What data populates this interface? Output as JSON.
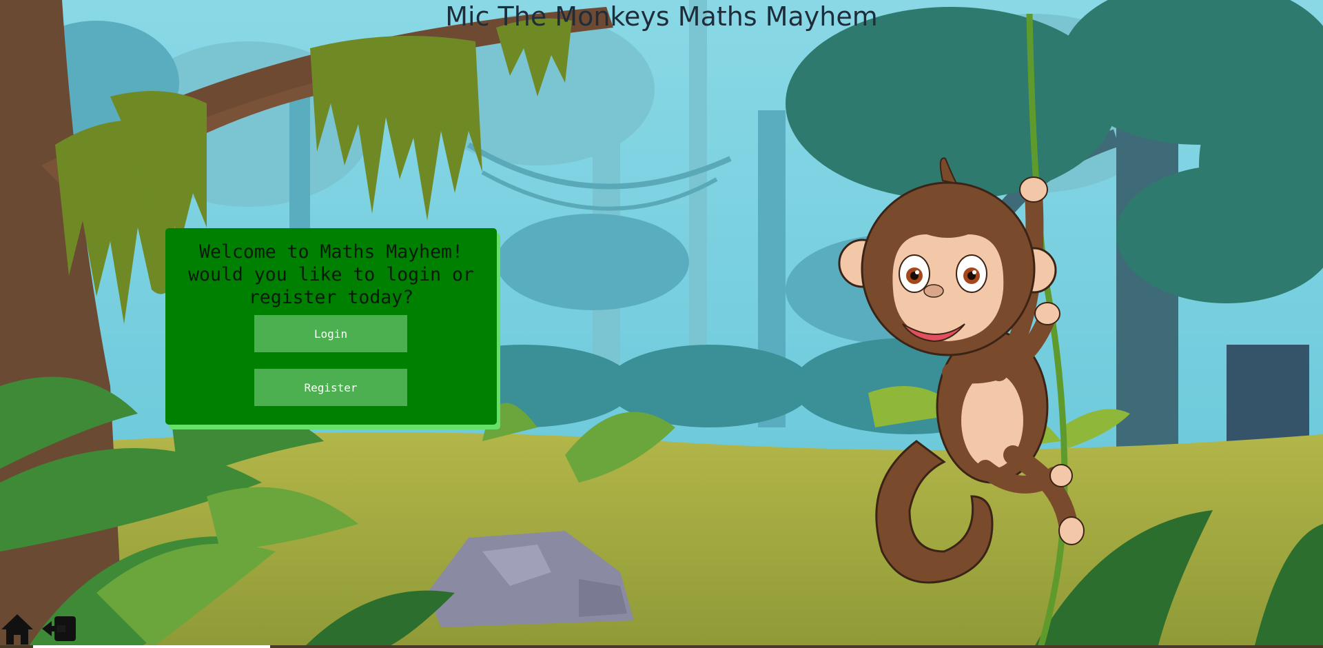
{
  "header": {
    "title": "Mic The Monkeys Maths Mayhem"
  },
  "welcome_panel": {
    "message": "Welcome to Maths Mayhem!\nwould you like to login or\nregister today?",
    "login_label": "Login",
    "register_label": "Register"
  },
  "footer_icons": {
    "home": "home-icon",
    "logout": "logout-icon"
  },
  "colors": {
    "panel_bg": "#008000",
    "panel_shadow": "#66e066",
    "button_bg": "#4caf50",
    "title_text": "#1f2d3a"
  }
}
